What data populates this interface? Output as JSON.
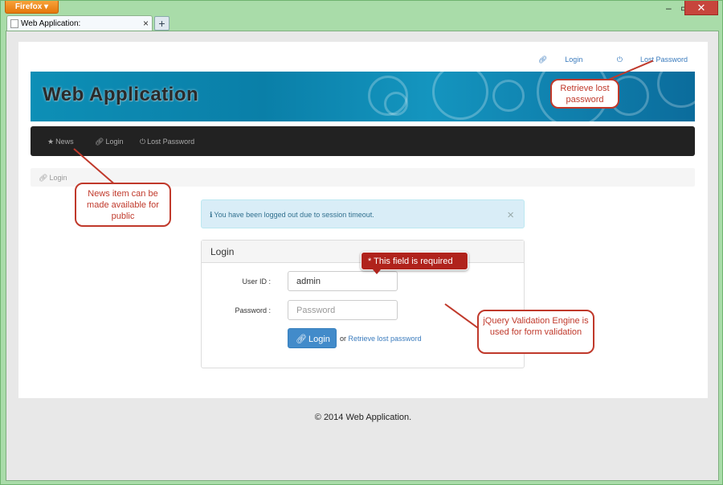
{
  "browser": {
    "menu_label": "Firefox ▾",
    "tab_title": "Web Application:",
    "tab_close": "×",
    "new_tab": "+",
    "minimize": "‒",
    "maximize": "▭",
    "close": "✕"
  },
  "toplinks": {
    "login": "Login",
    "lost_password": "Lost Password"
  },
  "banner": {
    "title": "Web Application"
  },
  "nav": {
    "news": "News",
    "login": "Login",
    "lost_password": "Lost Password"
  },
  "breadcrumb": {
    "current": "Login"
  },
  "alert": {
    "message": "You have been logged out due to session timeout.",
    "close": "×"
  },
  "login_panel": {
    "title": "Login",
    "user_id_label": "User ID :",
    "user_id_value": "admin",
    "password_label": "Password :",
    "password_placeholder": "Password",
    "login_button": "Login",
    "or_text": "or",
    "retrieve_link": "Retrieve lost password"
  },
  "validation": {
    "message": "* This field is required"
  },
  "annotations": {
    "retrieve": "Retrieve lost password",
    "news": "News item can be made available for public",
    "jquery": "jQuery Validation Engine is used for form validation"
  },
  "footer": {
    "text": "© 2014 Web Application."
  },
  "colors": {
    "accent": "#428bca",
    "navbar": "#222222",
    "error": "#b0231c",
    "callout": "#c0392b"
  }
}
